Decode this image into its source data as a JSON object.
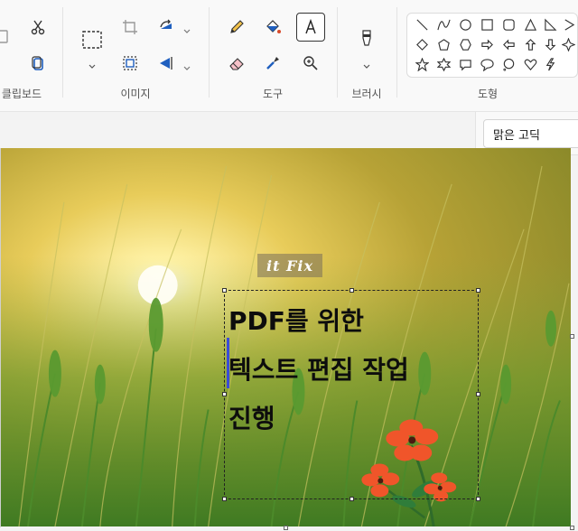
{
  "ribbon": {
    "groups": {
      "clipboard": {
        "label": "클립보드"
      },
      "image": {
        "label": "이미지"
      },
      "tools": {
        "label": "도구"
      },
      "brushes": {
        "label": "브러시"
      },
      "shapes": {
        "label": "도형"
      }
    },
    "tools_selected": "text"
  },
  "font": {
    "family": "맑은 고딕"
  },
  "canvas": {
    "watermark": "it Fix",
    "text_lines": [
      "PDF를 위한",
      "텍스트 편집 작업",
      "진행"
    ]
  },
  "colors": {
    "accent": "#3b4bd8",
    "ribbon_bg": "#f9f9f9"
  }
}
